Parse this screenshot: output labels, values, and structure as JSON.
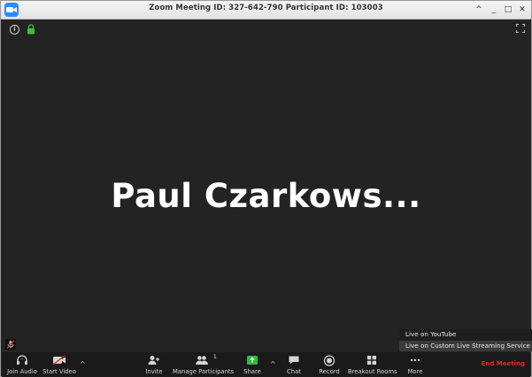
{
  "window": {
    "title": "Zoom Meeting ID: 327-642-790 Participant ID: 103003",
    "controls": [
      "^",
      "_",
      "□",
      "✕"
    ]
  },
  "stage": {
    "participant_name": "Paul Czarkows..."
  },
  "colors": {
    "accent": "#2d8cff",
    "stage_bg": "#232323",
    "toolbar_bg": "#1a1a1a",
    "lock": "#3fbf3f",
    "share": "#2bbd3f",
    "end": "#e02828"
  },
  "more_menu": {
    "items": [
      "Live on YouTube",
      "Live on Custom Live Streaming Service"
    ]
  },
  "toolbar": {
    "join_audio": "Join Audio",
    "start_video": "Start Video",
    "invite": "Invite",
    "manage_participants": "Manage Participants",
    "participants_count": "1",
    "share": "Share",
    "chat": "Chat",
    "record": "Record",
    "breakout_rooms": "Breakout Rooms",
    "more": "More",
    "end_meeting": "End Meeting"
  }
}
